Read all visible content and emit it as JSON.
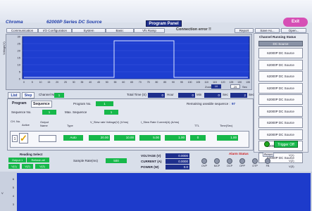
{
  "header": {
    "app_name": "Chroma",
    "series_title": "62000P Series DC Source",
    "panel_title": "Program Panel",
    "exit_label": "Exit",
    "error_text": "Connection error !!"
  },
  "toolbar": {
    "left_buttons": [
      "Communication",
      "I/O Configuration",
      "System",
      "Basic",
      "Vfs Ramp"
    ],
    "right_buttons": [
      "Report",
      "Save As...",
      "Open..."
    ]
  },
  "channel_panel": {
    "title": "Channel Running Status",
    "selected": "DC Source",
    "items": [
      "62000P DC Source",
      "62000P DC Source",
      "62000P DC Source",
      "62000P DC Source",
      "62000P DC Source",
      "62000P DC Source",
      "62000P DC Source",
      "62000P DC Source",
      "62000P DC Source",
      "62000P DC Source"
    ],
    "trigger_label": "Trigger Off"
  },
  "chart_top": {
    "ylabel": "Voltage(V)",
    "yticks": [
      "30",
      "25",
      "20",
      "15",
      "10",
      "5",
      "0"
    ],
    "xticks": [
      "0",
      "5",
      "10",
      "15",
      "20",
      "25",
      "30",
      "35",
      "40",
      "45",
      "50",
      "55",
      "60",
      "65",
      "70",
      "75",
      "80",
      "85",
      "90",
      "95",
      "100",
      "105",
      "110",
      "115",
      "120",
      "125",
      "130",
      "135"
    ],
    "xunit": "Sec",
    "scale_label": "Zoom",
    "scale_value": "10",
    "page_value": "29",
    "page_unit": "Sec"
  },
  "tabs": {
    "list": "List",
    "step": "Step",
    "channel_label": "Channel No.",
    "channel_value": "1",
    "total_time_label": "Total Time (S)",
    "total_time_value": "0",
    "hour_label": "Hour",
    "hour_value": "0",
    "min_label": "Min",
    "min_value": "0",
    "sec_label": "Sec",
    "sec_value": "2"
  },
  "program": {
    "tab_program": "Program",
    "tab_sequence": "Sequence",
    "program_no_label": "Program No.",
    "program_no_value": "1",
    "remaining_label": "Remaining useable sequence :",
    "remaining_value": "97",
    "seq_no_label": "Sequence No.",
    "seq_no_value": "1",
    "max_seq_label": "Max. Sequence",
    "max_seq_value": "1",
    "columns": [
      "CH. No.",
      "Active",
      "Output Name",
      "Type",
      "V_Slew rate Voltage(V) (V/ms)",
      "I_Slew Rate Current(A) (A/ms)",
      "TTL",
      "Time(Sec)"
    ],
    "row": {
      "ch": "1",
      "type": "Auto",
      "voltage": "20.00",
      "v_slew": "10.00",
      "current": "5.00",
      "i_slew": "1.00",
      "ttl": "0",
      "time": "1.00"
    }
  },
  "bottom": {
    "reading_select": "Reading Select",
    "output_label": "Output 1",
    "refresh_label": "Refresh all",
    "sel1": "V(1)",
    "sel2": "V(2)",
    "sel3": "V(3)",
    "sample_label": "Sample Rate(ms)",
    "sample_value": "500",
    "voltage_label": "VOLTAGE (V)",
    "voltage_value": "0.0000",
    "current_label": "CURRENT (A)",
    "current_value": "0.0000",
    "power_label": "POWER (W)",
    "power_value": "0.0",
    "alarm_title": "Alarm Status",
    "reset_label": "Reset",
    "alarms": [
      "OVP",
      "MCP",
      "OCP",
      "OPP",
      "OTP",
      "FB"
    ],
    "right_labels": [
      "V(1)",
      "V(2)",
      "V(3)"
    ]
  },
  "chart_bottom": {
    "yticks": [
      "6",
      "5",
      "4",
      "3"
    ],
    "ylabel": "V"
  }
}
